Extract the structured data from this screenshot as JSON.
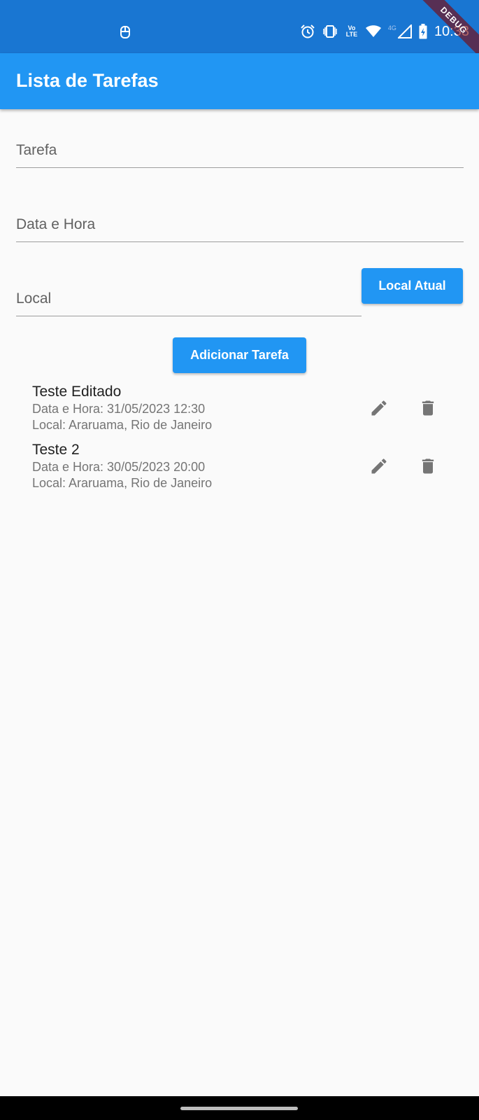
{
  "status_bar": {
    "time": "10:33",
    "network": "4G",
    "volte_line1": "Vo",
    "volte_line2": "LTE",
    "icons": [
      "notification-icon",
      "alarm-icon",
      "vibrate-icon",
      "volte-icon",
      "wifi-icon",
      "signal-icon",
      "battery-charging-icon"
    ]
  },
  "debug_banner": "DEBUG",
  "app_bar": {
    "title": "Lista de Tarefas",
    "color": "#2196f3"
  },
  "form": {
    "tarefa_placeholder": "Tarefa",
    "data_hora_placeholder": "Data e Hora",
    "local_placeholder": "Local",
    "local_atual_label": "Local Atual",
    "adicionar_label": "Adicionar Tarefa"
  },
  "tasks": [
    {
      "title": "Teste Editado",
      "datetime": "Data e Hora: 31/05/2023 12:30",
      "location": "Local: Araruama, Rio de Janeiro"
    },
    {
      "title": "Teste 2",
      "datetime": "Data e Hora: 30/05/2023 20:00",
      "location": "Local: Araruama, Rio de Janeiro"
    }
  ],
  "colors": {
    "primary": "#2196f3",
    "status_bar": "#1976d2",
    "icon_gray": "#757575"
  }
}
